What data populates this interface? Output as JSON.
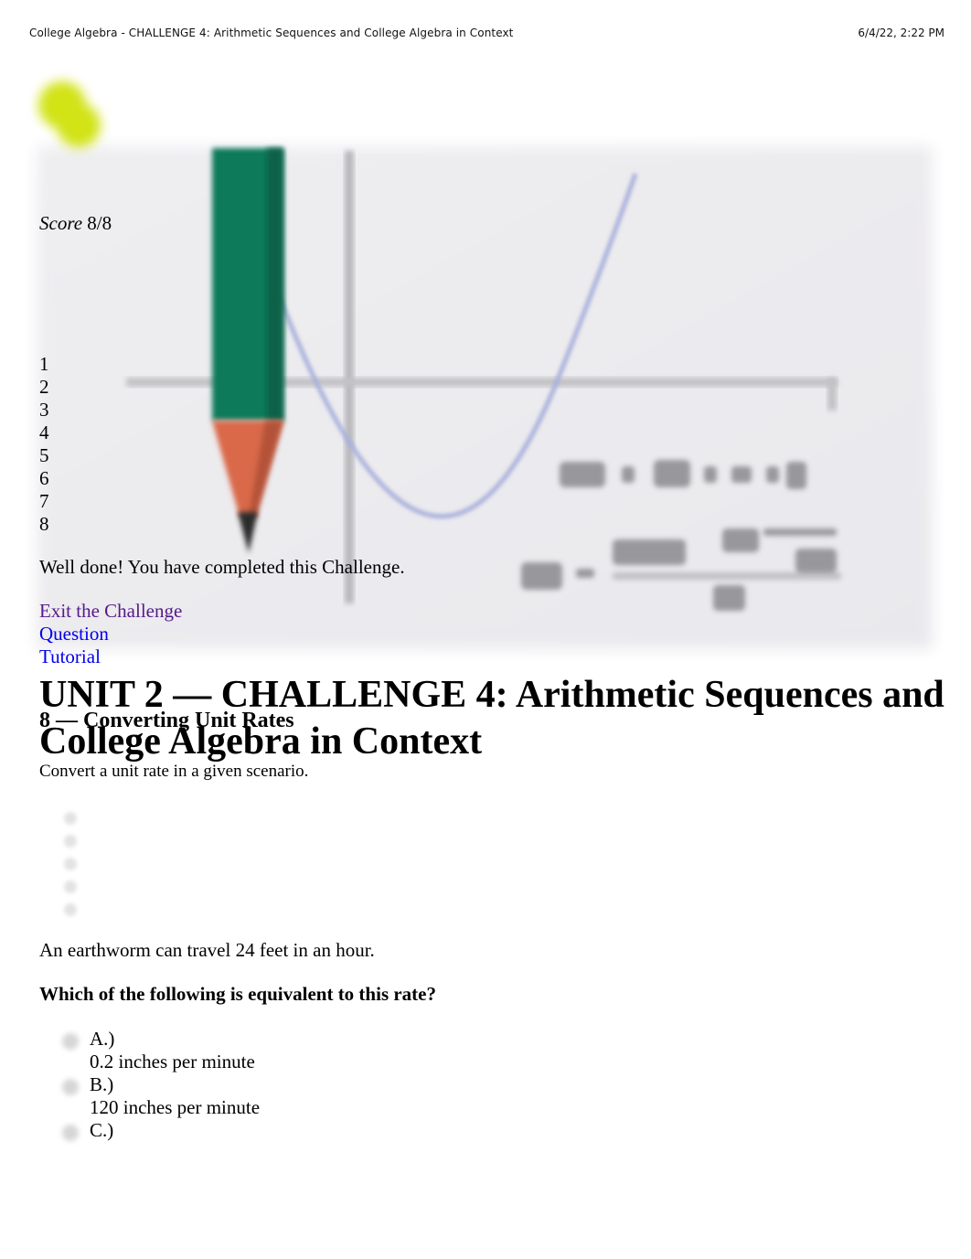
{
  "print_header": {
    "title": "College Algebra - CHALLENGE 4: Arithmetic Sequences and College Algebra in Context",
    "datetime": "6/4/22, 2:22 PM"
  },
  "background_art": {
    "description": "Blurred illustration of a pencil beside a parabola graph with quadratic formula",
    "icons": [
      "logo-blob-icon",
      "pencil-icon",
      "parabola-graph",
      "quadratic-formula"
    ]
  },
  "score": {
    "label": "Score",
    "value": "8/8"
  },
  "question_numbers": [
    "1",
    "2",
    "3",
    "4",
    "5",
    "6",
    "7",
    "8"
  ],
  "completion_message": "Well done! You have completed this Challenge.",
  "links": {
    "exit": "Exit the Challenge",
    "question": "Question",
    "tutorial": "Tutorial"
  },
  "colors": {
    "visited_link": "#551a8b",
    "link": "#0000ee",
    "pencil_green": "#0f7a5a",
    "pencil_tip": "#d9694a",
    "logo": "#cfe010",
    "curve": "#a8b0dc"
  },
  "unit_title": "UNIT 2 — CHALLENGE 4: Arithmetic Sequences and College Algebra in Context",
  "topic": {
    "title": "8 — Converting Unit Rates",
    "description": "Convert a unit rate in a given scenario."
  },
  "question": {
    "scenario": "An earthworm can travel 24 feet in an hour.",
    "prompt": "Which of the following is equivalent to this rate?",
    "options": [
      {
        "letter": "A.)",
        "answer": "0.2 inches per minute"
      },
      {
        "letter": "B.)",
        "answer": "120 inches per minute"
      },
      {
        "letter": "C.)",
        "answer": ""
      }
    ]
  }
}
